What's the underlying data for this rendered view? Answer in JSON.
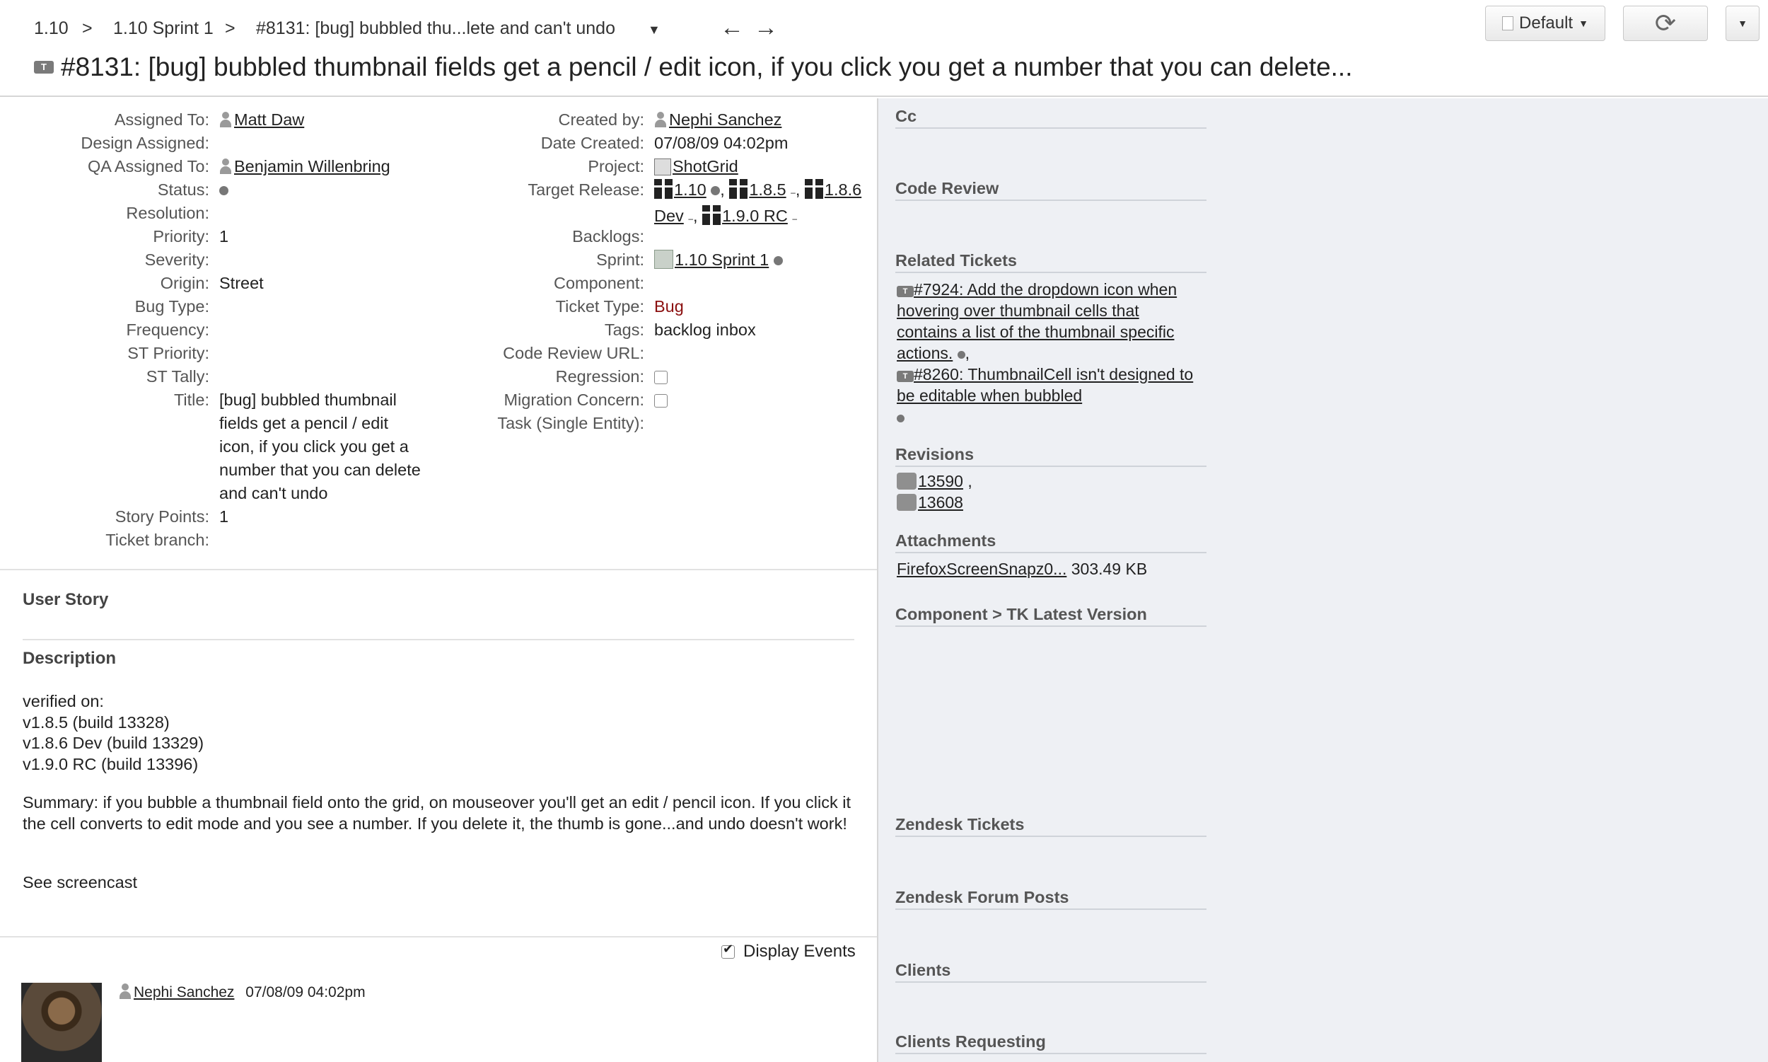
{
  "breadcrumb": {
    "project": "1.10",
    "sep1": ">",
    "sprint": "1.10 Sprint 1",
    "sep2": ">",
    "ticket": "#8131: [bug] bubbled thu...lete and can't undo"
  },
  "nav": {
    "prev": "←",
    "next": "→"
  },
  "page_title": "#8131: [bug] bubbled thumbnail fields get a pencil / edit icon, if you click you get a number that you can delete...",
  "toolbar": {
    "layout_label": "Default"
  },
  "ticket_icon_text": "T",
  "fields_left": [
    {
      "label": "Assigned To:",
      "value": "Matt Daw"
    },
    {
      "label": "Design Assigned:",
      "value": ""
    },
    {
      "label": "QA Assigned To:",
      "value": "Benjamin Willenbring"
    },
    {
      "label": "Status:",
      "value": ""
    },
    {
      "label": "Resolution:",
      "value": ""
    },
    {
      "label": "Priority:",
      "value": "1"
    },
    {
      "label": "Severity:",
      "value": ""
    },
    {
      "label": "Origin:",
      "value": "Street"
    },
    {
      "label": "Bug Type:",
      "value": ""
    },
    {
      "label": "Frequency:",
      "value": ""
    },
    {
      "label": "ST Priority:",
      "value": ""
    },
    {
      "label": "ST Tally:",
      "value": ""
    },
    {
      "label": "Title:",
      "value": "[bug] bubbled thumbnail fields get a pencil / edit icon, if you click you get a number that you can delete and can't undo"
    },
    {
      "label": "Story Points:",
      "value": "1"
    },
    {
      "label": "Ticket branch:",
      "value": ""
    }
  ],
  "fields_right": [
    {
      "label": "Created by:",
      "value": "Nephi Sanchez"
    },
    {
      "label": "Date Created:",
      "value": "07/08/09 04:02pm"
    },
    {
      "label": "Project:",
      "value": "ShotGrid"
    },
    {
      "label": "Target Release:",
      "value": ""
    },
    {
      "label": "Backlogs:",
      "value": ""
    },
    {
      "label": "Sprint:",
      "value": "1.10 Sprint 1"
    },
    {
      "label": "Component:",
      "value": ""
    },
    {
      "label": "Ticket Type:",
      "value": "Bug"
    },
    {
      "label": "Tags:",
      "value": "backlog inbox"
    },
    {
      "label": "Code Review URL:",
      "value": ""
    },
    {
      "label": "Regression:",
      "value": ""
    },
    {
      "label": "Migration Concern:",
      "value": ""
    },
    {
      "label": "Task (Single Entity):",
      "value": ""
    }
  ],
  "target_releases": [
    "1.10",
    "1.8.5",
    "1.8.6 Dev",
    "1.9.0 RC"
  ],
  "sections": {
    "user_story": "User Story",
    "description": "Description"
  },
  "description": {
    "verified": [
      "verified on:",
      "v1.8.5 (build 13328)",
      "v1.8.6 Dev (build 13329)",
      "v1.9.0 RC (build 13396)"
    ],
    "summary": "Summary: if you bubble a thumbnail field onto the grid, on mouseover you'll get an edit / pencil icon. If you click it the cell converts to edit mode and you see a number. If you delete it, the thumb is gone...and undo doesn't work!",
    "see": "See screencast"
  },
  "activity": {
    "display_events": "Display Events",
    "author": "Nephi Sanchez",
    "time": "07/08/09 04:02pm"
  },
  "sidebar": {
    "cc": "Cc",
    "code_review": "Code Review",
    "related_tickets": "Related Tickets",
    "related": [
      {
        "text": "#7924: Add the dropdown icon when hovering over thumbnail cells that contains a list of the thumbnail specific actions."
      },
      {
        "text": "#8260: ThumbnailCell isn't designed to be editable when bubbled"
      }
    ],
    "revisions": "Revisions",
    "revision_items": [
      "13590",
      "13608"
    ],
    "attachments": "Attachments",
    "attachment": {
      "name": "FirefoxScreenSnapz0...",
      "size": "303.49 KB"
    },
    "component_latest": "Component > TK Latest Version",
    "zendesk_tickets": "Zendesk Tickets",
    "zendesk_forum": "Zendesk Forum Posts",
    "clients": "Clients",
    "clients_requesting": "Clients Requesting"
  },
  "colors": {
    "bug": "#8b1010",
    "sidebar_bg": "#eef0f4"
  }
}
